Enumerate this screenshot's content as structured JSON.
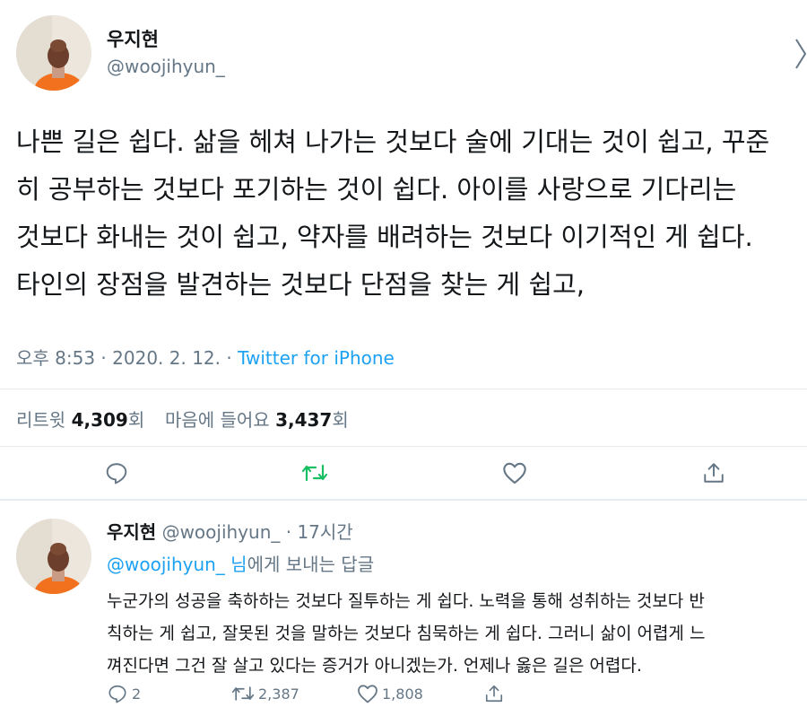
{
  "main_tweet": {
    "author_name": "우지현",
    "author_handle": "@woojihyun_",
    "text_lines": [
      "나쁜 길은 쉽다. 삶을 헤쳐 나가는 것보다 술에 기대는 것이 쉽고, 꾸준",
      "히 공부하는 것보다 포기하는 것이 쉽다. 아이를 사랑으로 기다리는",
      "것보다 화내는 것이 쉽고, 약자를 배려하는 것보다 이기적인 게 쉽다.",
      "타인의 장점을 발견하는 것보다 단점을 찾는 게 쉽고,"
    ],
    "timestamp": "오후 8:53 · 2020. 2. 12. · ",
    "source": "Twitter for iPhone",
    "retweet_label": "리트윗 ",
    "retweet_count": "4,309",
    "retweet_suffix": "회",
    "like_label": "마음에 들어요 ",
    "like_count": "3,437",
    "like_suffix": "회"
  },
  "reply_tweet": {
    "author_name": "우지현",
    "author_handle": "@woojihyun_",
    "time_sep": " · ",
    "time_ago": "17시간",
    "reply_to_handle": "@woojihyun_",
    "reply_to_suffix_honorific": " 님",
    "reply_to_suffix": "에게 보내는 답글",
    "text_lines": [
      "누군가의 성공을 축하하는 것보다 질투하는 게 쉽다. 노력을 통해 성취하는 것보다 반",
      "칙하는 게 쉽고, 잘못된 것을 말하는 것보다 침묵하는 게 쉽다. 그러니 삶이 어렵게 느",
      "껴진다면 그건 잘 살고 있다는 증거가 아니겠는가. 언제나 옳은 길은 어렵다."
    ],
    "reply_count": "2",
    "retweet_count": "2,387",
    "like_count": "1,808"
  },
  "icons": {
    "reply": "reply-icon",
    "retweet": "retweet-icon",
    "like": "heart-icon",
    "share": "share-icon"
  },
  "colors": {
    "link_blue": "#1da1f2",
    "retweet_green": "#17bf63",
    "secondary_text": "#657786",
    "divider": "#e6ecf0"
  }
}
